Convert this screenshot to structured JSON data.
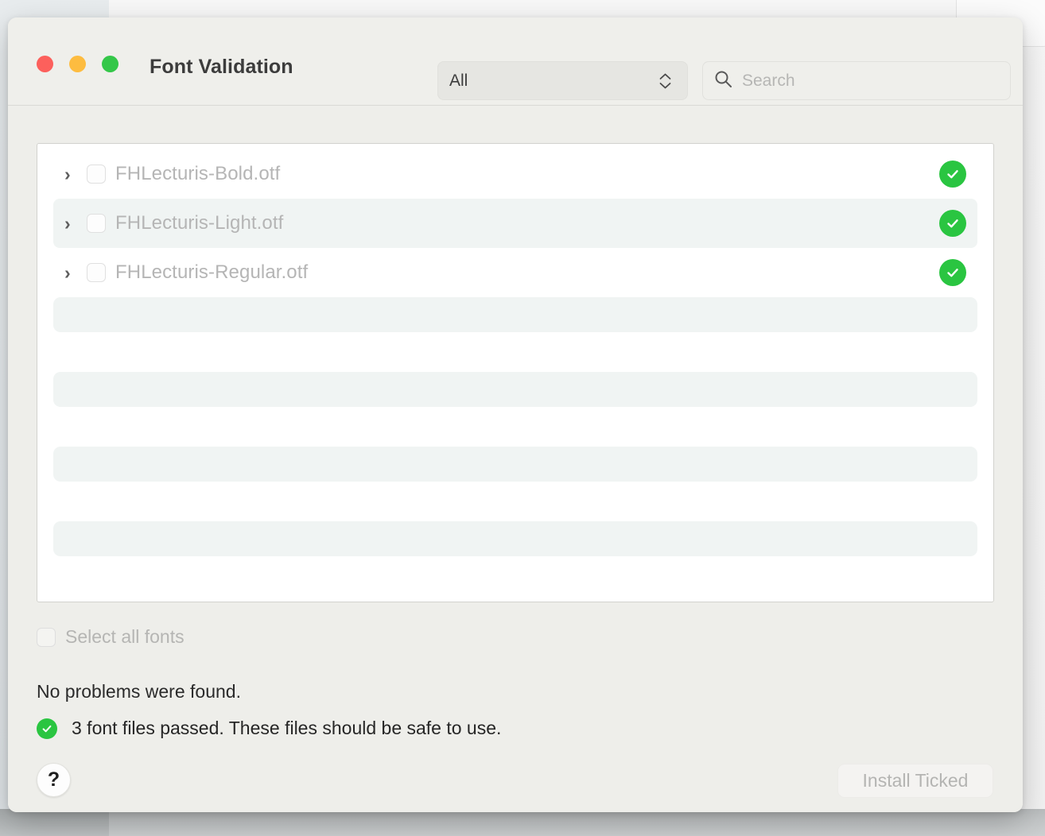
{
  "window": {
    "title": "Font Validation",
    "traffic_lights": [
      {
        "name": "close",
        "color": "#fc605c"
      },
      {
        "name": "minimize",
        "color": "#fdbc40"
      },
      {
        "name": "zoom",
        "color": "#34c749"
      }
    ]
  },
  "toolbar": {
    "filter": {
      "selected": "All",
      "options": [
        "All"
      ]
    },
    "search": {
      "value": "",
      "placeholder": "Search",
      "icon": "search-icon"
    }
  },
  "list": {
    "rows": [
      {
        "name": "FHLecturis-Bold.otf",
        "checked": false,
        "expanded": false,
        "status": "passed",
        "striped": false
      },
      {
        "name": "FHLecturis-Light.otf",
        "checked": false,
        "expanded": false,
        "status": "passed",
        "striped": true
      },
      {
        "name": "FHLecturis-Regular.otf",
        "checked": false,
        "expanded": false,
        "status": "passed",
        "striped": false
      }
    ],
    "empty_placeholder_rows": 4
  },
  "select_all": {
    "label": "Select all fonts",
    "checked": false,
    "enabled": false
  },
  "status": {
    "headline": "No problems were found.",
    "detail": "3 font files passed. These files should be safe to use.",
    "badge": "check-circle-icon",
    "badge_color": "#2ac541"
  },
  "footer": {
    "help_label": "?",
    "install_label": "Install Ticked",
    "install_enabled": false
  }
}
